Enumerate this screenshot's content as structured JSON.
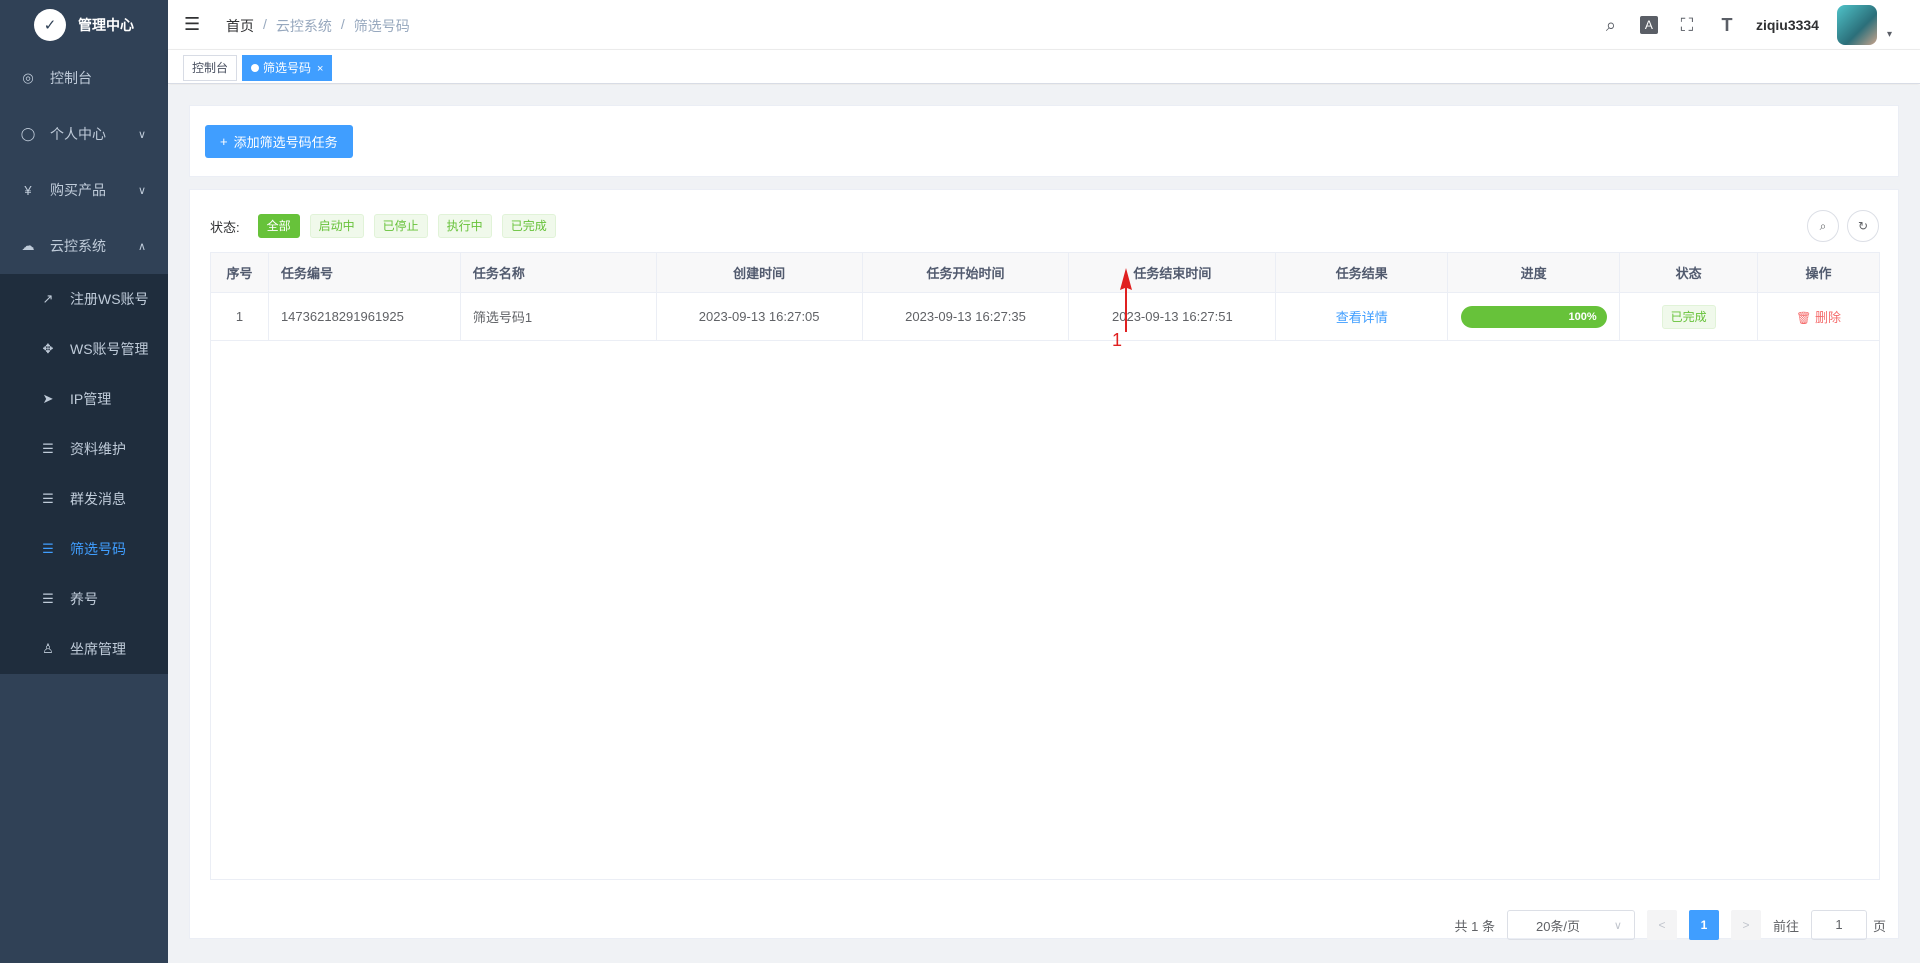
{
  "app": {
    "title": "管理中心",
    "logo_glyph": "✓"
  },
  "sidebar": {
    "items": [
      {
        "label": "控制台",
        "icon": "dashboard-icon",
        "glyph": "◎"
      },
      {
        "label": "个人中心",
        "icon": "user-center-icon",
        "glyph": "◯",
        "arrow": "∨"
      },
      {
        "label": "购买产品",
        "icon": "yen-icon",
        "glyph": "¥",
        "arrow": "∨"
      },
      {
        "label": "云控系统",
        "icon": "cloud-icon",
        "glyph": "☁",
        "arrow": "∧"
      }
    ],
    "submenu": [
      {
        "label": "注册WS账号",
        "icon": "external-link-icon",
        "glyph": "↗"
      },
      {
        "label": "WS账号管理",
        "icon": "move-icon",
        "glyph": "✥"
      },
      {
        "label": "IP管理",
        "icon": "send-icon",
        "glyph": "➤"
      },
      {
        "label": "资料维护",
        "icon": "list-icon",
        "glyph": "☰"
      },
      {
        "label": "群发消息",
        "icon": "list-icon",
        "glyph": "☰"
      },
      {
        "label": "筛选号码",
        "icon": "list-icon",
        "glyph": "☰",
        "active": true
      },
      {
        "label": "养号",
        "icon": "list-icon",
        "glyph": "☰"
      },
      {
        "label": "坐席管理",
        "icon": "person-icon",
        "glyph": "♙"
      }
    ]
  },
  "navbar": {
    "hamburger": "☰",
    "breadcrumb": [
      "首页",
      "/",
      "云控系统",
      "/",
      "筛选号码"
    ],
    "icons": {
      "search": "⌕",
      "translate": "A",
      "fullscreen": "⛶",
      "font_size": "T"
    },
    "username": "ziqiu3334",
    "caret": "▾"
  },
  "tags": [
    {
      "label": "控制台"
    },
    {
      "label": "筛选号码",
      "close": "×"
    }
  ],
  "toolbar": {
    "add_label": "添加筛选号码任务",
    "add_glyph": "+"
  },
  "filter": {
    "label": "状态:",
    "options": [
      "全部",
      "启动中",
      "已停止",
      "执行中",
      "已完成"
    ],
    "search_glyph": "⌕",
    "refresh_glyph": "↻"
  },
  "table": {
    "headers": [
      "序号",
      "任务编号",
      "任务名称",
      "创建时间",
      "任务开始时间",
      "任务结束时间",
      "任务结果",
      "进度",
      "状态",
      "操作"
    ],
    "rows": [
      {
        "index": "1",
        "task_id": "14736218291961925",
        "task_name": "筛选号码1",
        "created": "2023-09-13 16:27:05",
        "started": "2023-09-13 16:27:35",
        "ended": "2023-09-13 16:27:51",
        "result_link": "查看详情",
        "progress": 1.0,
        "progress_label": "100%",
        "status": "已完成",
        "action": "删除",
        "action_glyph": "🗑"
      }
    ]
  },
  "annotation": {
    "label": "1",
    "color": "#e02020"
  },
  "pagination": {
    "total": "共 1 条",
    "page_size": "20条/页",
    "size_caret": "∨",
    "prev": "<",
    "next": ">",
    "current": "1",
    "goto_label": "前往",
    "goto_value": "1",
    "goto_suffix": "页"
  },
  "colors": {
    "primary": "#409eff",
    "sidebar_bg": "#304156",
    "success": "#67c23a",
    "danger": "#f56c6c"
  }
}
